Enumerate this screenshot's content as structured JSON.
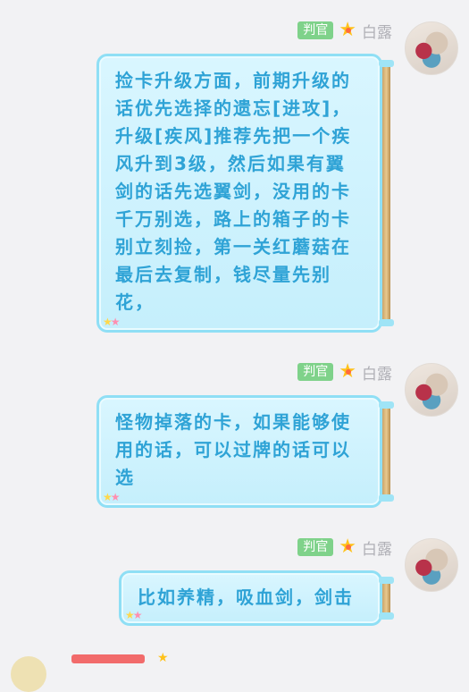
{
  "messages": [
    {
      "tag": "判官",
      "name": "白露",
      "text": "捡卡升级方面，前期升级的话优先选择的遗忘[进攻]，升级[疾风]推荐先把一个疾风升到3级，然后如果有翼剑的话先选翼剑，没用的卡千万别选，路上的箱子的卡别立刻捡，第一关红蘑菇在最后去复制，钱尽量先别花，"
    },
    {
      "tag": "判官",
      "name": "白露",
      "text": "怪物掉落的卡，如果能够使用的话，可以过牌的话可以选"
    },
    {
      "tag": "判官",
      "name": "白露",
      "text": "比如养精，吸血剑，剑击"
    }
  ],
  "colors": {
    "tag_bg": "#7fd28a",
    "bubble_text": "#2fa3d6",
    "bubble_border": "#8fdff5",
    "name_text": "#b0b0b6",
    "star": "#ffc21a"
  }
}
